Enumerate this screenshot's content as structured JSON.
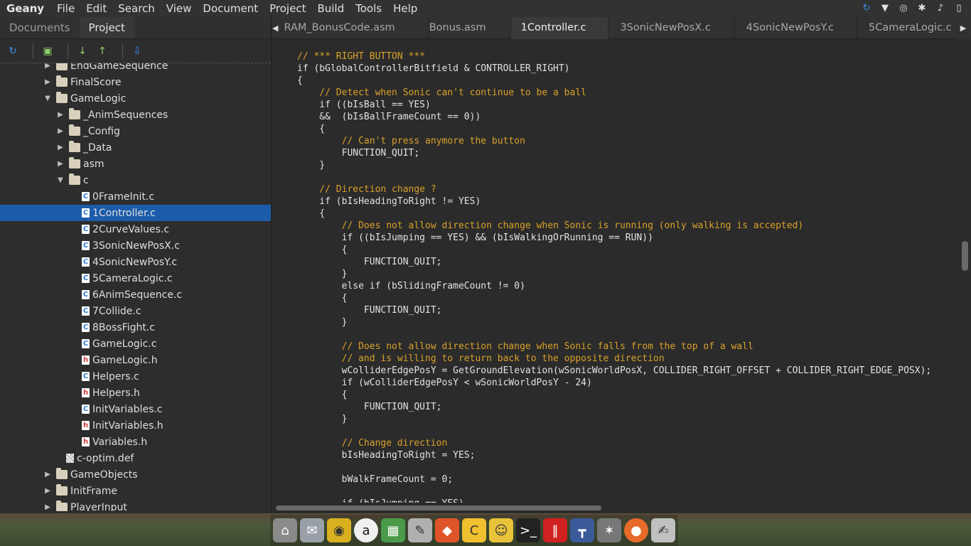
{
  "menubar": {
    "app": "Geany",
    "items": [
      "File",
      "Edit",
      "Search",
      "View",
      "Document",
      "Project",
      "Build",
      "Tools",
      "Help"
    ]
  },
  "sidebar": {
    "tabs": [
      "Documents",
      "Project"
    ],
    "active_tab": "Project",
    "tree": [
      {
        "label": "EndGameSequence",
        "type": "folder",
        "depth": 1,
        "expanded": false
      },
      {
        "label": "FinalScore",
        "type": "folder",
        "depth": 1,
        "expanded": false
      },
      {
        "label": "GameLogic",
        "type": "folder",
        "depth": 1,
        "expanded": true
      },
      {
        "label": "_AnimSequences",
        "type": "folder",
        "depth": 2,
        "expanded": false
      },
      {
        "label": "_Config",
        "type": "folder",
        "depth": 2,
        "expanded": false
      },
      {
        "label": "_Data",
        "type": "folder",
        "depth": 2,
        "expanded": false
      },
      {
        "label": "asm",
        "type": "folder",
        "depth": 2,
        "expanded": false
      },
      {
        "label": "c",
        "type": "folder",
        "depth": 2,
        "expanded": true
      },
      {
        "label": "0FrameInit.c",
        "type": "c",
        "depth": 3
      },
      {
        "label": "1Controller.c",
        "type": "c",
        "depth": 3,
        "selected": true
      },
      {
        "label": "2CurveValues.c",
        "type": "c",
        "depth": 3
      },
      {
        "label": "3SonicNewPosX.c",
        "type": "c",
        "depth": 3
      },
      {
        "label": "4SonicNewPosY.c",
        "type": "c",
        "depth": 3
      },
      {
        "label": "5CameraLogic.c",
        "type": "c",
        "depth": 3
      },
      {
        "label": "6AnimSequence.c",
        "type": "c",
        "depth": 3
      },
      {
        "label": "7Collide.c",
        "type": "c",
        "depth": 3
      },
      {
        "label": "8BossFight.c",
        "type": "c",
        "depth": 3
      },
      {
        "label": "GameLogic.c",
        "type": "c",
        "depth": 3
      },
      {
        "label": "GameLogic.h",
        "type": "h",
        "depth": 3
      },
      {
        "label": "Helpers.c",
        "type": "c",
        "depth": 3
      },
      {
        "label": "Helpers.h",
        "type": "h",
        "depth": 3
      },
      {
        "label": "InitVariables.c",
        "type": "c",
        "depth": 3
      },
      {
        "label": "InitVariables.h",
        "type": "h",
        "depth": 3
      },
      {
        "label": "Variables.h",
        "type": "h",
        "depth": 3
      },
      {
        "label": "c-optim.def",
        "type": "def",
        "depth": 2
      },
      {
        "label": "GameObjects",
        "type": "folder",
        "depth": 1,
        "expanded": false
      },
      {
        "label": "InitFrame",
        "type": "folder",
        "depth": 1,
        "expanded": false
      },
      {
        "label": "PlayerInput",
        "type": "folder",
        "depth": 1,
        "expanded": false
      }
    ]
  },
  "editor": {
    "tabs": [
      "RAM_BonusCode.asm",
      "Bonus.asm",
      "1Controller.c",
      "3SonicNewPosX.c",
      "4SonicNewPosY.c",
      "5CameraLogic.c"
    ],
    "active_tab": "1Controller.c",
    "lines": [
      "// *** RIGHT BUTTON ***",
      "if (bGlobalControllerBitfield & CONTROLLER_RIGHT)",
      "{",
      "    // Detect when Sonic can't continue to be a ball",
      "    if ((bIsBall == YES)",
      "    &&  (bIsBallFrameCount == 0))",
      "    {",
      "        // Can't press anymore the button",
      "        FUNCTION_QUIT;",
      "    }",
      "",
      "    // Direction change ?",
      "    if (bIsHeadingToRight != YES)",
      "    {",
      "        // Does not allow direction change when Sonic is running (only walking is accepted)",
      "        if ((bIsJumping == YES) && (bIsWalkingOrRunning == RUN))",
      "        {",
      "            FUNCTION_QUIT;",
      "        }",
      "        else if (bSlidingFrameCount != 0)",
      "        {",
      "            FUNCTION_QUIT;",
      "        }",
      "",
      "        // Does not allow direction change when Sonic falls from the top of a wall",
      "        // and is willing to return back to the opposite direction",
      "        wColliderEdgePosY = GetGroundElevation(wSonicWorldPosX, COLLIDER_RIGHT_OFFSET + COLLIDER_RIGHT_EDGE_POSX);",
      "        if (wColliderEdgePosY < wSonicWorldPosY - 24)",
      "        {",
      "            FUNCTION_QUIT;",
      "        }",
      "",
      "        // Change direction",
      "        bIsHeadingToRight = YES;",
      "",
      "        bWalkFrameCount = 0;",
      "",
      "        if (bIsJumping == YES)"
    ]
  },
  "icons": {
    "tray": [
      "sync-icon",
      "wifi-icon",
      "browser-icon",
      "bluetooth-icon",
      "volume-icon",
      "battery-icon"
    ],
    "toolbar": [
      "refresh-icon",
      "new-folder-icon",
      "move-down-icon",
      "move-up-icon",
      "collapse-icon"
    ],
    "dock": [
      "home-folder-icon",
      "mail-clock-icon",
      "audio-icon",
      "amazon-icon",
      "spreadsheet-icon",
      "notes-icon",
      "git-icon",
      "code-editor-icon",
      "chat-icon",
      "terminal-icon",
      "color-bars-icon",
      "tetris-icon",
      "gimp-icon",
      "firefox-icon",
      "text-editor-icon"
    ]
  }
}
